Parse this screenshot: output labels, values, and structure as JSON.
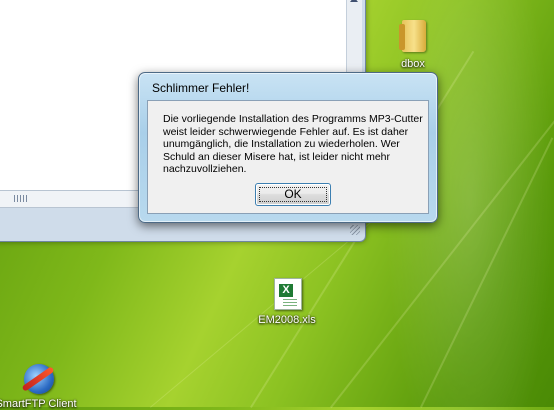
{
  "dialog": {
    "title": "Schlimmer Fehler!",
    "message": "Die vorliegende Installation des Programms MP3-Cutter\nweist leider schwerwiegende Fehler auf. Es ist daher\nunumgänglich, die Installation zu wiederholen. Wer\nSchuld an dieser Misere hat, ist leider nicht mehr\nnachzuvollziehen.",
    "ok_label": "OK"
  },
  "desktop_icons": [
    {
      "label": "dbox",
      "icon": "folder-icon"
    },
    {
      "label": "EM2008.xls",
      "icon": "excel-file-icon"
    },
    {
      "label": "SmartFTP Client",
      "icon": "smartftp-icon"
    }
  ],
  "xls_badge": "X",
  "colors": {
    "dialog_frame": "#a9cfe9",
    "dialog_body": "#f0f0f0",
    "ok_border": "#3c7fb1",
    "wallpaper": "#7fb81a"
  }
}
